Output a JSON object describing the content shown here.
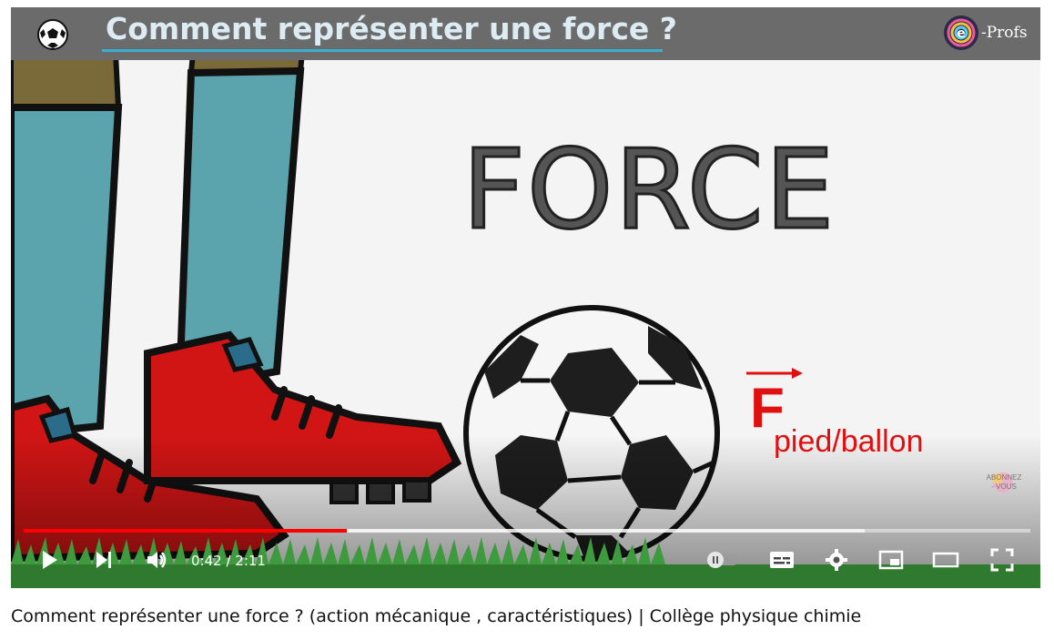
{
  "banner": {
    "title": "Comment représenter une force ?",
    "logo_text": "-Profs",
    "logo_letter": "e"
  },
  "scene": {
    "force_word": "FORCE",
    "vector_letter": "F",
    "vector_subscript": "pied/ballon",
    "subscribe_line1": "ABONNEZ",
    "subscribe_line2": "- VOUS"
  },
  "player": {
    "progress_played": 0.321,
    "progress_buffered": 0.835,
    "time_current": "0:42",
    "time_total": "2:11",
    "time_display": "0:42 / 2:11"
  },
  "icons": [
    "play-icon",
    "next-icon",
    "volume-icon",
    "autoplay-toggle-icon",
    "subtitles-icon",
    "settings-icon",
    "miniplayer-icon",
    "theater-icon",
    "fullscreen-icon"
  ],
  "colors": {
    "progress": "#ff0000",
    "vector": "#e01010",
    "boot": "#d11515",
    "sock": "#5ba3ad",
    "grass": "#2f7a2f"
  },
  "video": {
    "title": "Comment représenter une force ? (action mécanique , caractéristiques) | Collège physique chimie"
  }
}
